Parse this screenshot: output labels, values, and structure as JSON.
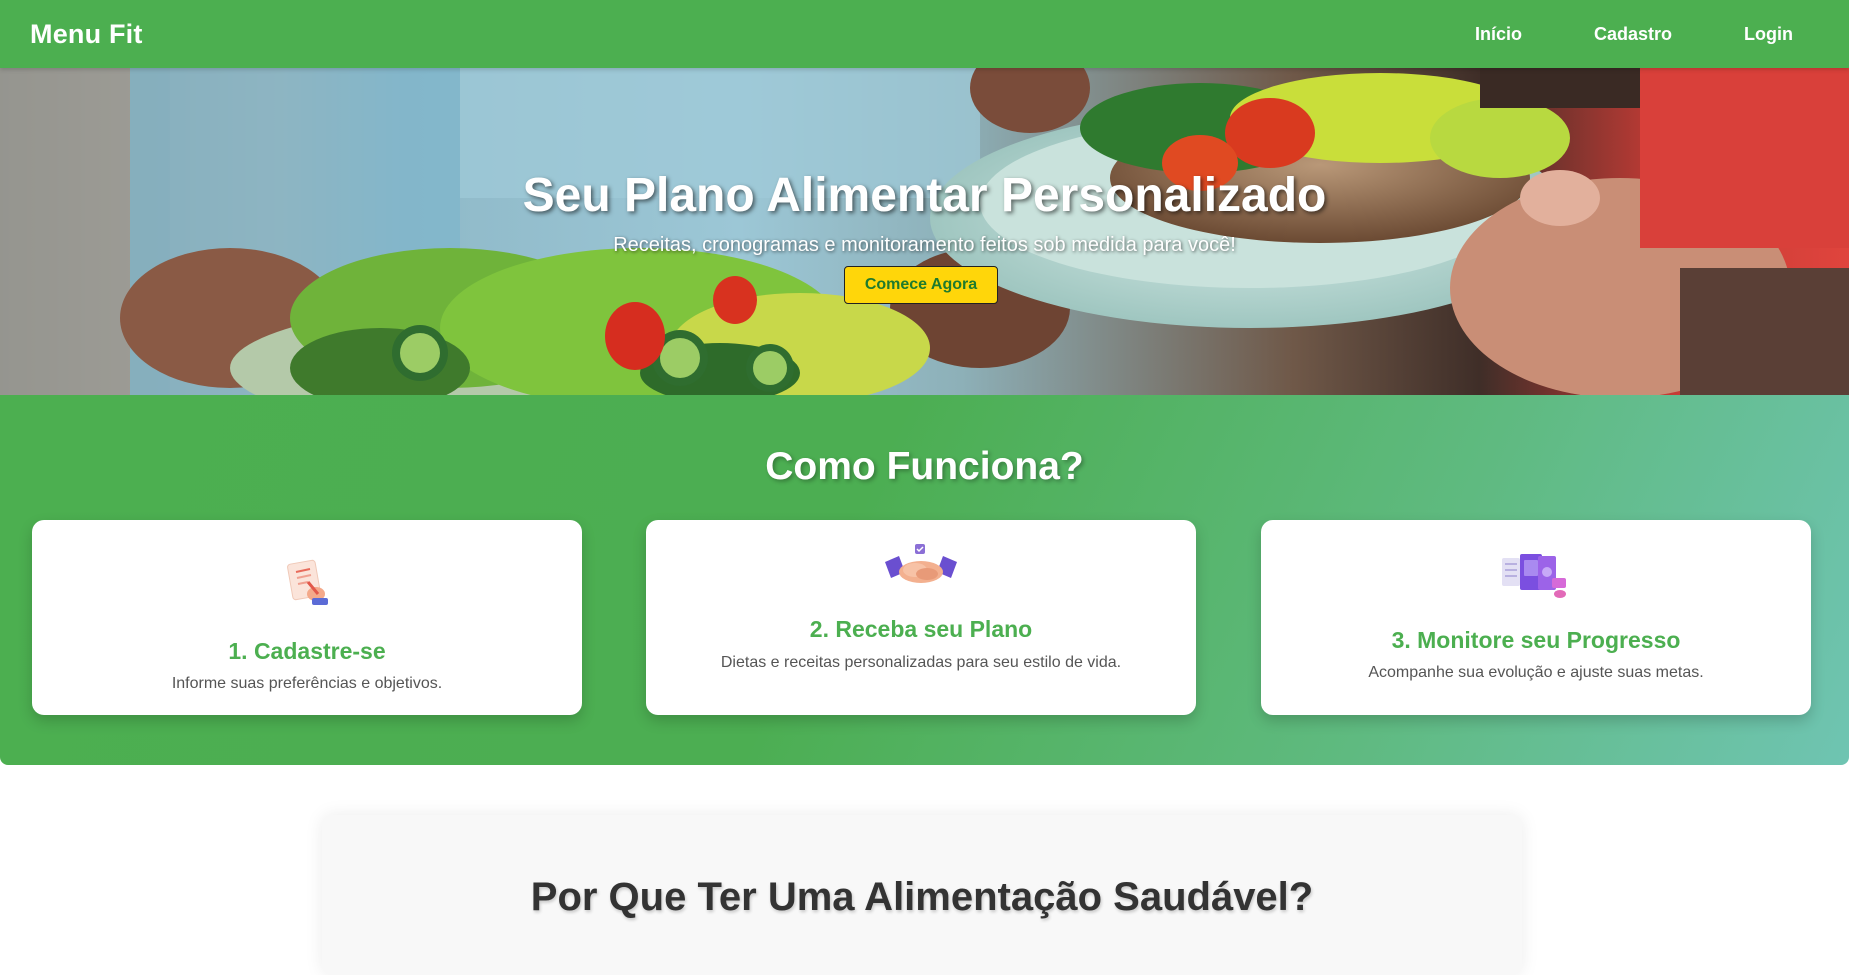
{
  "navbar": {
    "brand": "Menu Fit",
    "links": [
      "Início",
      "Cadastro",
      "Login"
    ]
  },
  "hero": {
    "title": "Seu Plano Alimentar Personalizado",
    "subtitle": "Receitas, cronogramas e monitoramento feitos sob medida para você!",
    "cta": "Comece Agora"
  },
  "how_it_works": {
    "title": "Como Funciona?",
    "steps": [
      {
        "icon": "document-writing-icon",
        "title": "1. Cadastre-se",
        "text": "Informe suas preferências e objetivos."
      },
      {
        "icon": "handshake-icon",
        "title": "2. Receba seu Plano",
        "text": "Dietas e receitas personalizadas para seu estilo de vida."
      },
      {
        "icon": "devices-progress-icon",
        "title": "3. Monitore seu Progresso",
        "text": "Acompanhe sua evolução e ajuste suas metas."
      }
    ]
  },
  "why": {
    "title": "Por Que Ter Uma Alimentação Saudável?"
  },
  "colors": {
    "primary_green": "#4caf50",
    "cta_yellow": "#ffd60a",
    "gradient_teal": "#6fc4b2"
  }
}
